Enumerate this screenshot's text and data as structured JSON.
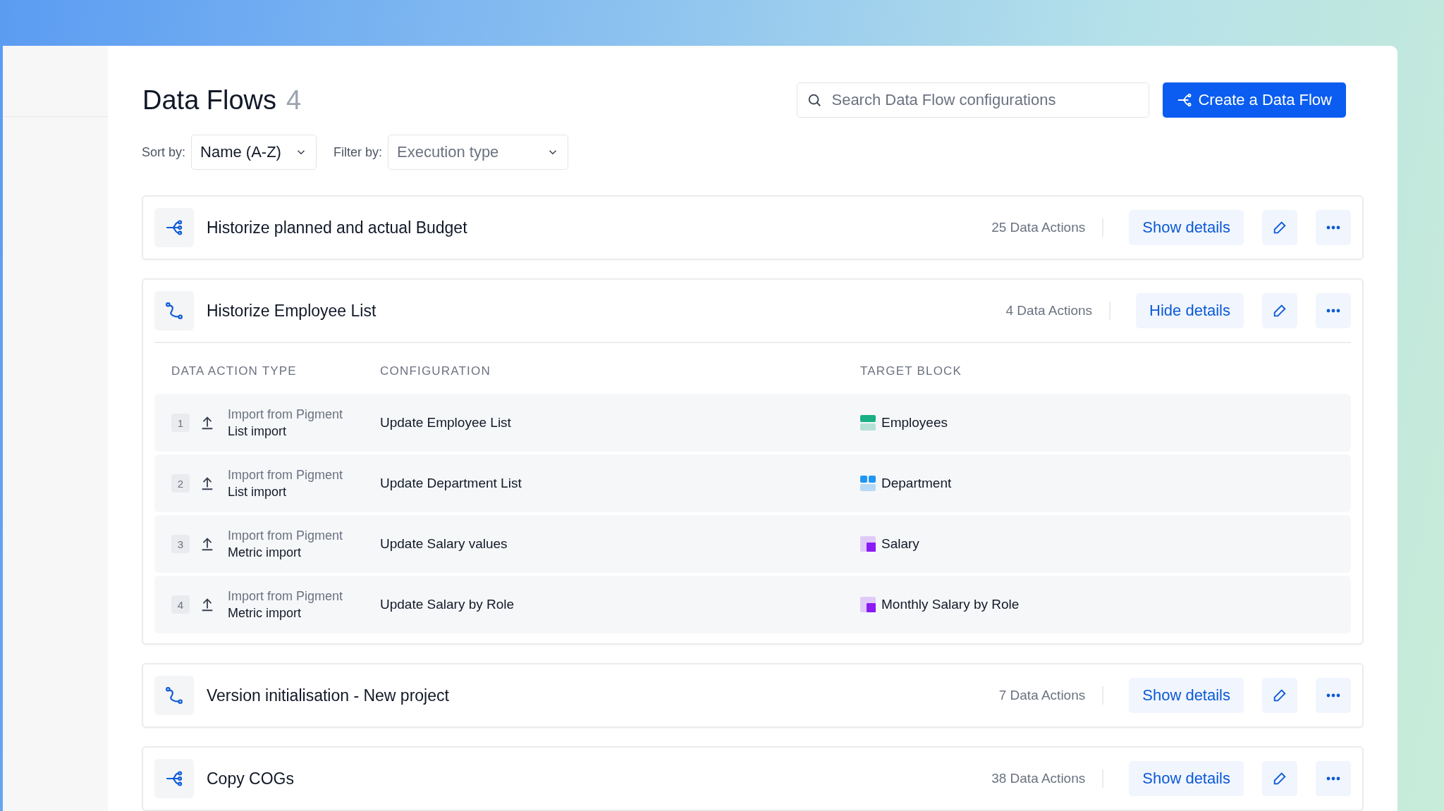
{
  "page": {
    "title": "Data Flows",
    "count": "4"
  },
  "search": {
    "placeholder": "Search Data Flow configurations"
  },
  "create_button": {
    "label": "Create a Data Flow"
  },
  "sort": {
    "label": "Sort by:",
    "value": "Name (A-Z)"
  },
  "filter": {
    "label": "Filter by:",
    "placeholder": "Execution type"
  },
  "flows": [
    {
      "kind": "branch",
      "name": "Historize planned and actual Budget",
      "actions": "25 Data Actions",
      "toggle": "Show details",
      "expanded": false
    },
    {
      "kind": "sequence",
      "name": "Historize Employee List",
      "actions": "4 Data Actions",
      "toggle": "Hide details",
      "expanded": true,
      "columns": [
        "DATA ACTION TYPE",
        "CONFIGURATION",
        "TARGET BLOCK"
      ],
      "rows": [
        {
          "index": "1",
          "source": "Import from Pigment",
          "type": "List import",
          "configuration": "Update Employee List",
          "target": {
            "kind": "list",
            "color": "#1aaf85",
            "name": "Employees"
          }
        },
        {
          "index": "2",
          "source": "Import from Pigment",
          "type": "List import",
          "configuration": "Update Department List",
          "target": {
            "kind": "grid",
            "color": "#2196f3",
            "name": "Department"
          }
        },
        {
          "index": "3",
          "source": "Import from Pigment",
          "type": "Metric import",
          "configuration": "Update Salary values",
          "target": {
            "kind": "metric",
            "color": "#8b1cf5",
            "name": "Salary"
          }
        },
        {
          "index": "4",
          "source": "Import from Pigment",
          "type": "Metric import",
          "configuration": "Update Salary by Role",
          "target": {
            "kind": "metric",
            "color": "#8b1cf5",
            "name": "Monthly Salary by Role"
          }
        }
      ]
    },
    {
      "kind": "sequence",
      "name": "Version initialisation - New project",
      "actions": "7 Data Actions",
      "toggle": "Show details",
      "expanded": false
    },
    {
      "kind": "branch",
      "name": "Copy COGs",
      "actions": "38 Data Actions",
      "toggle": "Show details",
      "expanded": false
    }
  ]
}
